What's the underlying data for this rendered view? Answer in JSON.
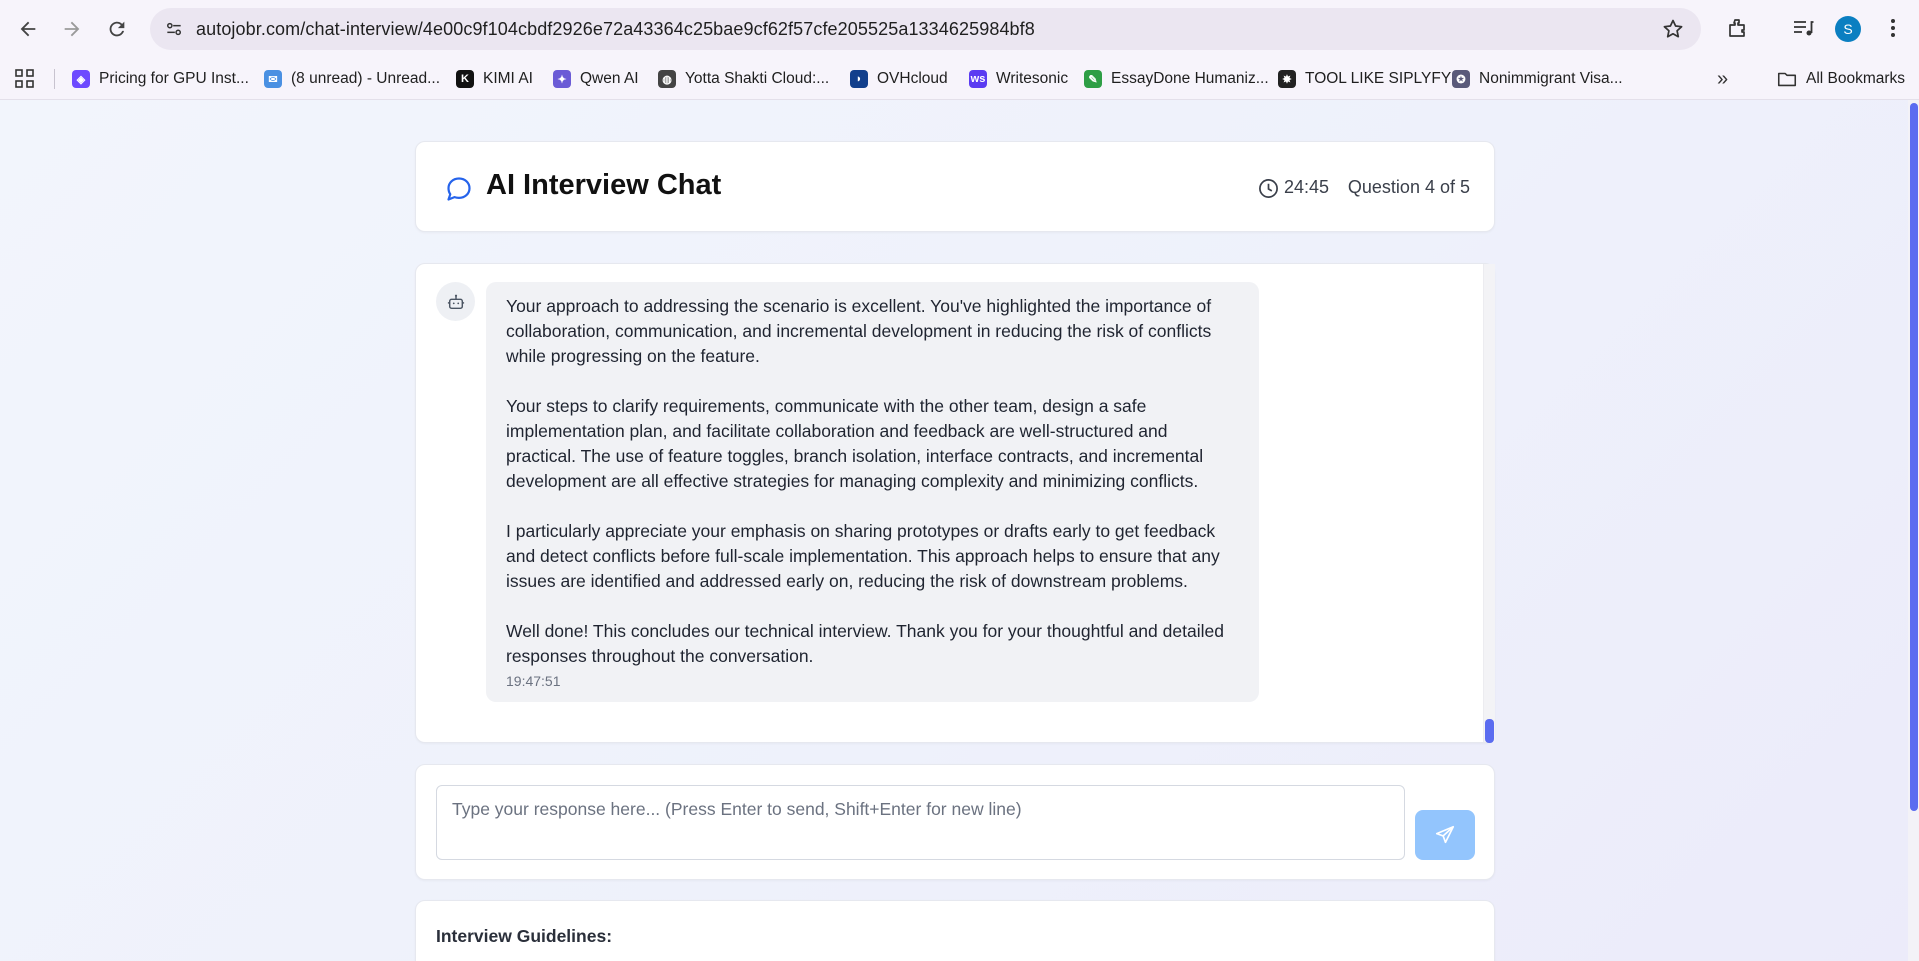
{
  "browser": {
    "url": "autojobr.com/chat-interview/4e00c9f104cbdf2926e72a43364c25bae9cf62f57cfe205525a1334625984bf8",
    "profile_initial": "S",
    "bookmarks": [
      {
        "label": "Pricing for GPU Inst...",
        "icon": "cube-icon",
        "color": "#6d4aff"
      },
      {
        "label": "(8 unread) - Unread...",
        "icon": "mail-icon",
        "color": "#4a90e2"
      },
      {
        "label": "KIMI AI",
        "icon": "kimi-icon",
        "color": "#111111"
      },
      {
        "label": "Qwen AI",
        "icon": "qwen-icon",
        "color": "#6b5bd6"
      },
      {
        "label": "Yotta Shakti Cloud:...",
        "icon": "globe-icon",
        "color": "#444444"
      },
      {
        "label": "OVHcloud",
        "icon": "ovh-icon",
        "color": "#123f8c"
      },
      {
        "label": "Writesonic",
        "icon": "writesonic-icon",
        "color": "#5b3cf2"
      },
      {
        "label": "EssayDone Humaniz...",
        "icon": "essaydone-icon",
        "color": "#2e9e45"
      },
      {
        "label": "TOOL LIKE SIPLYFY",
        "icon": "tool-icon",
        "color": "#222222"
      },
      {
        "label": "Nonimmigrant Visa...",
        "icon": "seal-icon",
        "color": "#5a5a7a"
      }
    ],
    "all_bookmarks_label": "All Bookmarks"
  },
  "header": {
    "title": "AI Interview Chat",
    "timer": "24:45",
    "question_progress": "Question 4 of 5"
  },
  "message": {
    "paragraphs": [
      "Your approach to addressing the scenario is excellent. You've highlighted the importance of collaboration, communication, and incremental development in reducing the risk of conflicts while progressing on the feature.",
      "Your steps to clarify requirements, communicate with the other team, design a safe implementation plan, and facilitate collaboration and feedback are well-structured and practical. The use of feature toggles, branch isolation, interface contracts, and incremental development are all effective strategies for managing complexity and minimizing conflicts.",
      "I particularly appreciate your emphasis on sharing prototypes or drafts early to get feedback and detect conflicts before full-scale implementation. This approach helps to ensure that any issues are identified and addressed early on, reducing the risk of downstream problems.",
      "Well done! This concludes our technical interview. Thank you for your thoughtful and detailed responses throughout the conversation."
    ],
    "timestamp": "19:47:51"
  },
  "composer": {
    "placeholder": "Type your response here... (Press Enter to send, Shift+Enter for new line)",
    "value": ""
  },
  "guidelines": {
    "title": "Interview Guidelines:"
  },
  "colors": {
    "accent": "#2563eb",
    "send_button": "#93c5fd",
    "scroll_thumb": "#5b6cf0"
  }
}
